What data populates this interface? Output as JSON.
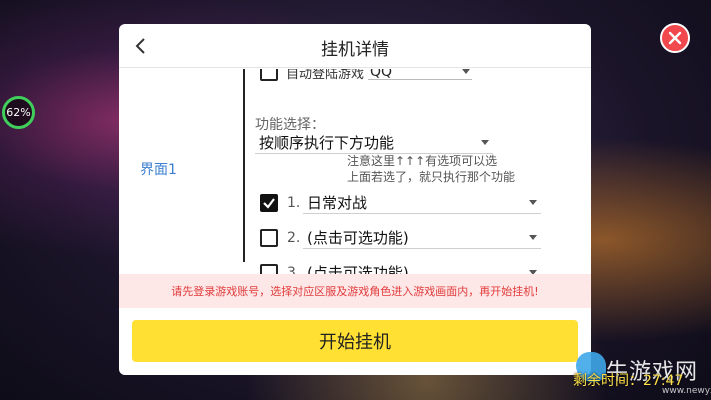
{
  "background": {
    "battery_percent": "62%"
  },
  "dialog": {
    "title": "挂机详情",
    "tab_label": "界面1",
    "partial_row": {
      "checkbox_checked": false,
      "label": "自动登陆游戏",
      "select_value": "QQ"
    },
    "function_label": "功能选择：",
    "function_select": "按顺序执行下方功能",
    "note_lines": [
      "注意这里↑↑↑有选项可以选",
      "上面若选了，就只执行那个功能"
    ],
    "options": [
      {
        "num": "1.",
        "checked": true,
        "value": "日常对战"
      },
      {
        "num": "2.",
        "checked": false,
        "value": "(点击可选功能)"
      },
      {
        "num": "3.",
        "checked": false,
        "value": "(点击可选功能)"
      }
    ],
    "warning": "请先登录游戏账号，选择对应区服及游戏角色进入游戏画面内，再开始挂机!",
    "start_button": "开始挂机"
  },
  "overlay": {
    "watermark_name": "牛游戏网",
    "watermark_url": "www.newyx.net",
    "timer_text": "剩余时间：27:47"
  },
  "colors": {
    "accent_yellow": "#ffe033",
    "warning_red": "#e23b3b",
    "warning_bg": "#fde7e7",
    "tab_blue": "#3a7fd0",
    "close_red": "#f0484c"
  }
}
